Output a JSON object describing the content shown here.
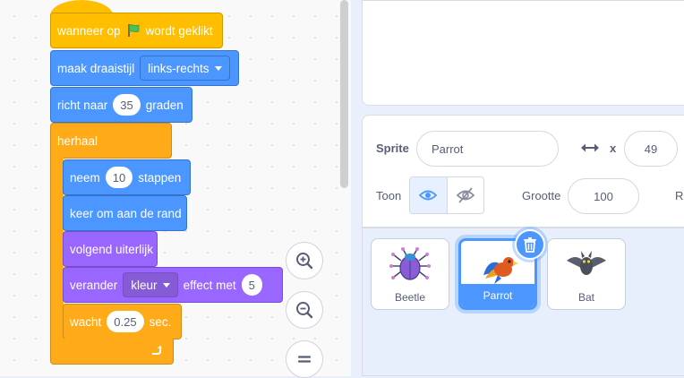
{
  "script": {
    "hat": {
      "prefix": "wanneer op",
      "suffix": "wordt geklikt",
      "flag_icon": "green-flag-icon"
    },
    "set_rotation": {
      "label": "maak draaistijl",
      "value": "links-rechts"
    },
    "point_direction": {
      "prefix": "richt naar",
      "value": "35",
      "suffix": "graden"
    },
    "forever": {
      "label": "herhaal"
    },
    "move": {
      "prefix": "neem",
      "value": "10",
      "suffix": "stappen"
    },
    "bounce": {
      "label": "keer om aan de rand"
    },
    "next_costume": {
      "label": "volgend uiterlijk"
    },
    "change_effect": {
      "prefix": "verander",
      "effect": "kleur",
      "middle": "effect met",
      "value": "5"
    },
    "wait": {
      "prefix": "wacht",
      "value": "0.25",
      "suffix": "sec."
    }
  },
  "zoom_controls": [
    "zoom-in-icon",
    "zoom-out-icon",
    "zoom-reset-icon"
  ],
  "sprite_info": {
    "sprite_label": "Sprite",
    "sprite_name": "Parrot",
    "x_label": "x",
    "x_value": "49",
    "show_label": "Toon",
    "size_label": "Grootte",
    "size_value": "100",
    "direction_label_partial": "R"
  },
  "sprites": [
    {
      "name": "Beetle",
      "selected": false
    },
    {
      "name": "Parrot",
      "selected": true
    },
    {
      "name": "Bat",
      "selected": false
    }
  ],
  "colors": {
    "events": "#ffbf00",
    "motion": "#4c97ff",
    "looks": "#9966ff",
    "control": "#ffab19"
  }
}
